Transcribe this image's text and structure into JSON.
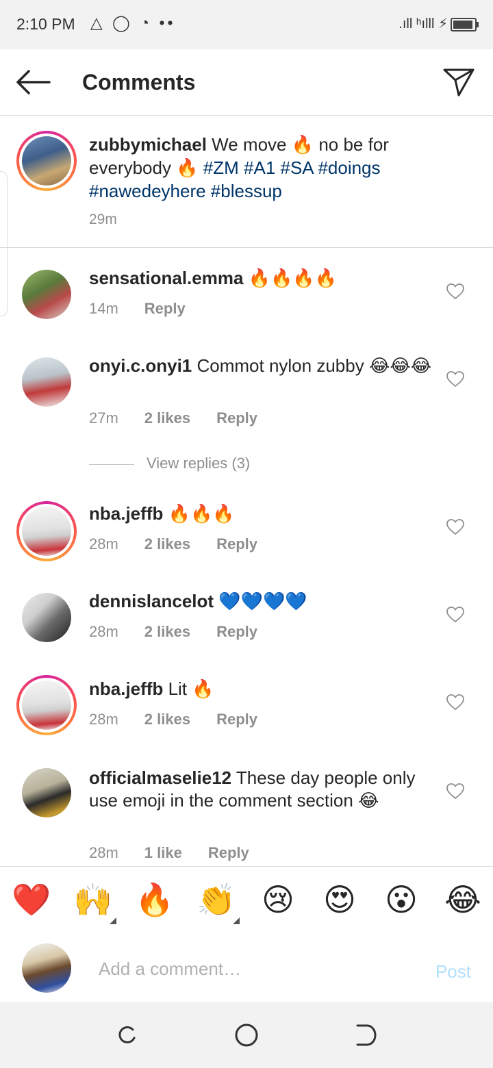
{
  "status_bar": {
    "time": "2:10 PM",
    "left_icons": "△ ◯ ◔ ••",
    "right_icons": ".ıll ʰılll ⚡"
  },
  "header": {
    "title": "Comments"
  },
  "caption": {
    "username": "zubbymichael",
    "text_part1": " We move ",
    "emoji1": "🔥",
    "text_part2": " no be for everybody ",
    "emoji2": "🔥",
    "hashtags": "#ZM #A1 #SA #doings #nawedeyhere #blessup",
    "time": "29m"
  },
  "comments": [
    {
      "username": "sensational.emma",
      "text": " ",
      "emojis": "🔥🔥🔥🔥",
      "time": "14m",
      "likes": "",
      "reply": "Reply"
    },
    {
      "username": "onyi.c.onyi1",
      "text": " Commot nylon zubby ",
      "emojis": "😂😂😂",
      "time": "27m",
      "likes": "2 likes",
      "reply": "Reply"
    },
    {
      "username": "nba.jeffb",
      "text": " ",
      "emojis": "🔥🔥🔥",
      "time": "28m",
      "likes": "2 likes",
      "reply": "Reply"
    },
    {
      "username": "dennislancelot",
      "text": " ",
      "emojis": "💙💙💙💙",
      "time": "28m",
      "likes": "2 likes",
      "reply": "Reply"
    },
    {
      "username": "nba.jeffb",
      "text": " Lit ",
      "emojis": "🔥",
      "time": "28m",
      "likes": "2 likes",
      "reply": "Reply"
    },
    {
      "username": "officialmaselie12",
      "text": " These day people only use emoji in the comment section ",
      "emojis": "😂",
      "time": "28m",
      "likes": "1 like",
      "reply": "Reply"
    }
  ],
  "view_replies": "View replies (3)",
  "emoji_bar": [
    "❤️",
    "🙌",
    "🔥",
    "👏",
    "😢",
    "😍",
    "😮",
    "😂"
  ],
  "composer": {
    "placeholder": "Add a comment…",
    "post_label": "Post"
  },
  "colors": {
    "hashtag": "#003569",
    "meta": "#8e8e8e",
    "post_disabled": "#b2dffc"
  }
}
